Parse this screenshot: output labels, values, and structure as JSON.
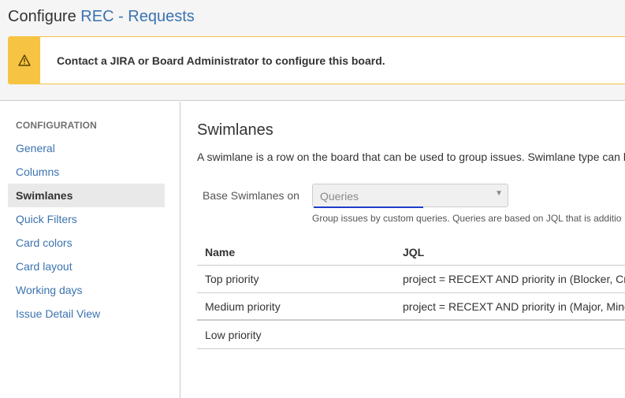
{
  "header": {
    "title_prefix": "Configure",
    "board_name": "REC - Requests"
  },
  "warning": {
    "icon": "warning-icon",
    "message": "Contact a JIRA or Board Administrator to configure this board."
  },
  "sidebar": {
    "heading": "CONFIGURATION",
    "items": [
      {
        "label": "General",
        "active": false
      },
      {
        "label": "Columns",
        "active": false
      },
      {
        "label": "Swimlanes",
        "active": true
      },
      {
        "label": "Quick Filters",
        "active": false
      },
      {
        "label": "Card colors",
        "active": false
      },
      {
        "label": "Card layout",
        "active": false
      },
      {
        "label": "Working days",
        "active": false
      },
      {
        "label": "Issue Detail View",
        "active": false
      }
    ]
  },
  "main": {
    "title": "Swimlanes",
    "description": "A swimlane is a row on the board that can be used to group issues. Swimlane type can b",
    "base_label": "Base Swimlanes on",
    "base_value": "Queries",
    "help_text": "Group issues by custom queries. Queries are based on JQL that is additio",
    "table": {
      "headers": [
        "Name",
        "JQL"
      ],
      "rows": [
        {
          "name": "Top priority",
          "jql": "project = RECEXT AND priority in (Blocker, Cri"
        },
        {
          "name": "Medium priority",
          "jql": "project = RECEXT AND priority in (Major, Mino"
        },
        {
          "name": "Low priority",
          "jql": ""
        }
      ]
    }
  },
  "colors": {
    "link": "#3b73af",
    "warning": "#f6c342"
  }
}
